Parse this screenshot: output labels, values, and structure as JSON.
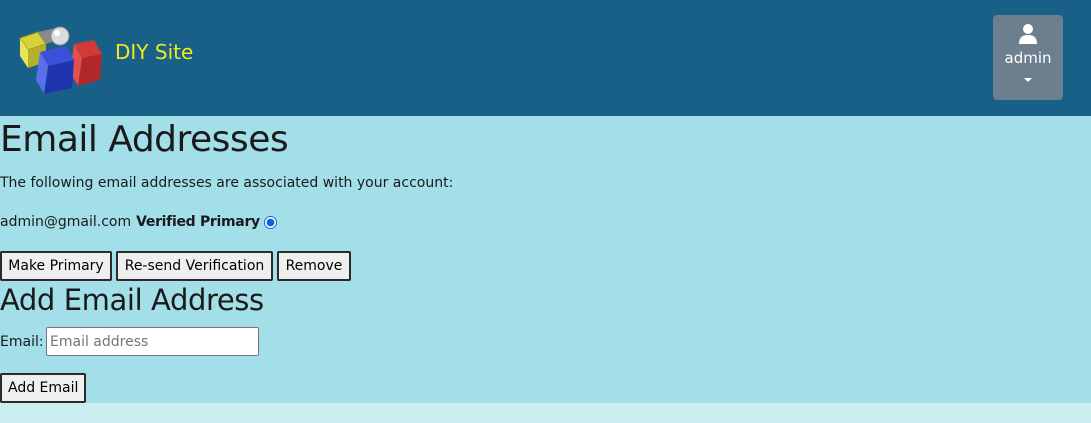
{
  "header": {
    "site_name": "DIY Site",
    "user_menu_label": "admin",
    "logo_icon": "cubes-logo-icon",
    "user_icon": "user-icon",
    "caret_icon": "caret-down-icon"
  },
  "page": {
    "title": "Email Addresses",
    "intro": "The following email addresses are associated with your account:"
  },
  "emails": [
    {
      "address": "admin@gmail.com",
      "status": "Verified Primary",
      "selected": true
    }
  ],
  "actions": {
    "make_primary": "Make Primary",
    "resend": "Re-send Verification",
    "remove": "Remove"
  },
  "add_form": {
    "title": "Add Email Address",
    "label": "Email:",
    "placeholder": "Email address",
    "value": "",
    "submit": "Add Email"
  },
  "colors": {
    "navbar": "#186087",
    "brand_text": "#f2ea1c",
    "content_bg": "#a3dfe8",
    "page_bg": "#cdeef0",
    "user_button": "#6c7f8f"
  }
}
